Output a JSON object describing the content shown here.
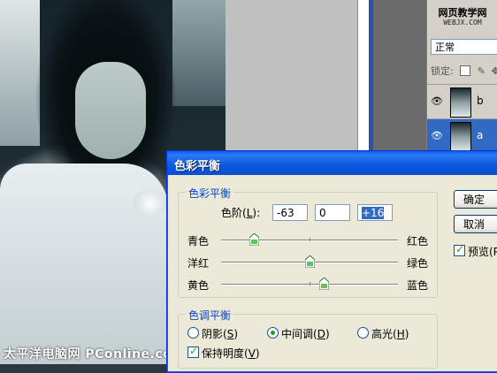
{
  "watermark": "太平洋电脑网 PConline.com.cn",
  "layers_panel": {
    "site_title": "网页教学网",
    "site_url": "WEBJX.COM",
    "blend_mode": "正常",
    "lock_label": "锁定:",
    "layers": [
      {
        "name": "b",
        "selected": false
      },
      {
        "name": "a",
        "selected": true
      }
    ]
  },
  "dialog": {
    "title": "色彩平衡",
    "color_balance_group": "色彩平衡",
    "levels_label": "色阶",
    "levels_hotkey": "L",
    "levels_values": [
      "-63",
      "0",
      "+16"
    ],
    "sliders": [
      {
        "left": "青色",
        "right": "红色",
        "value": -63
      },
      {
        "left": "洋红",
        "right": "绿色",
        "value": 0
      },
      {
        "left": "黄色",
        "right": "蓝色",
        "value": 16
      }
    ],
    "tone_group": "色调平衡",
    "tones": [
      {
        "label": "阴影",
        "hotkey": "S",
        "selected": false
      },
      {
        "label": "中间调",
        "hotkey": "D",
        "selected": true
      },
      {
        "label": "高光",
        "hotkey": "H",
        "selected": false
      }
    ],
    "preserve_label": "保持明度",
    "preserve_hotkey": "V",
    "preserve_checked": true,
    "ok_label": "确定",
    "cancel_label": "取消",
    "preview_label": "预览(P",
    "preview_checked": true
  }
}
